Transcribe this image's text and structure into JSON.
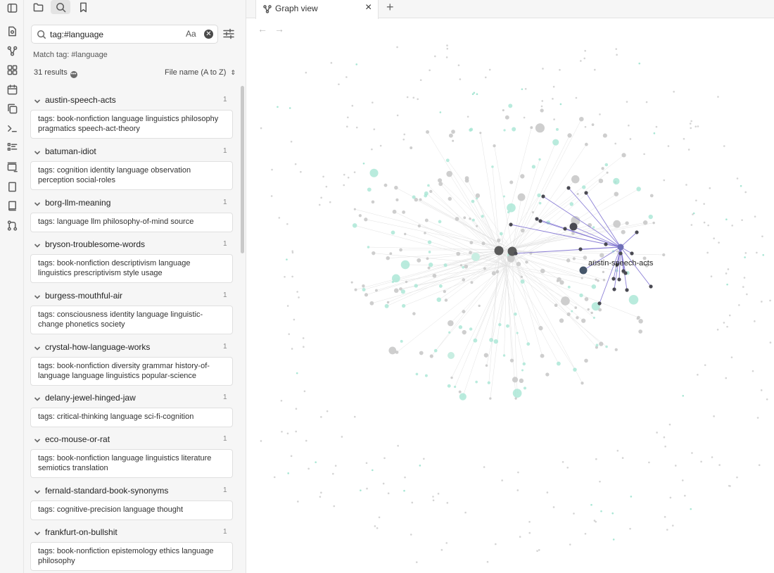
{
  "search": {
    "query": "tag:#language",
    "case_label": "Aa",
    "match_label": "Match tag: #language",
    "results_count": "31 results",
    "sort_label": "File name (A to Z)"
  },
  "results": [
    {
      "name": "austin-speech-acts",
      "count": "1",
      "match": "tags: book-nonfiction language linguistics philosophy pragmatics speech-act-theory"
    },
    {
      "name": "batuman-idiot",
      "count": "1",
      "match": "tags: cognition identity language observation perception social-roles"
    },
    {
      "name": "borg-llm-meaning",
      "count": "1",
      "match": "tags: language llm philosophy-of-mind source"
    },
    {
      "name": "bryson-troublesome-words",
      "count": "1",
      "match": "tags: book-nonfiction descriptivism language linguistics prescriptivism style usage"
    },
    {
      "name": "burgess-mouthful-air",
      "count": "1",
      "match": "tags: consciousness identity language linguistic-change phonetics society"
    },
    {
      "name": "crystal-how-language-works",
      "count": "1",
      "match": "tags: book-nonfiction diversity grammar history-of-language language linguistics popular-science"
    },
    {
      "name": "delany-jewel-hinged-jaw",
      "count": "1",
      "match": "tags: critical-thinking language sci-fi-cognition"
    },
    {
      "name": "eco-mouse-or-rat",
      "count": "1",
      "match": "tags: book-nonfiction language linguistics literature semiotics translation"
    },
    {
      "name": "fernald-standard-book-synonyms",
      "count": "1",
      "match": "tags: cognitive-precision language thought"
    },
    {
      "name": "frankfurt-on-bullshit",
      "count": "1",
      "match": "tags: book-nonfiction epistemology ethics language philosophy"
    }
  ],
  "tab": {
    "label": "Graph view",
    "close": "×",
    "new": "+"
  },
  "nav": {
    "back": "←",
    "forward": "→"
  },
  "graph": {
    "highlight_label": "austin-speech-acts",
    "colors": {
      "node": "#c9c9c9",
      "node_tag": "#a8e6d4",
      "focus_node": "#4a4a52",
      "focus_edge": "#8b7fd6",
      "edge": "#e2e2e2"
    }
  },
  "icons": {
    "ribbon": [
      "sidebar-toggle-icon",
      "file-icon",
      "graph-icon",
      "canvas-icon",
      "calendar-icon",
      "copy-icon",
      "terminal-icon",
      "list-icon",
      "card-add-icon",
      "page-icon",
      "book-icon",
      "git-icon"
    ],
    "pane": [
      "folder-icon",
      "search-icon",
      "bookmark-icon"
    ]
  }
}
